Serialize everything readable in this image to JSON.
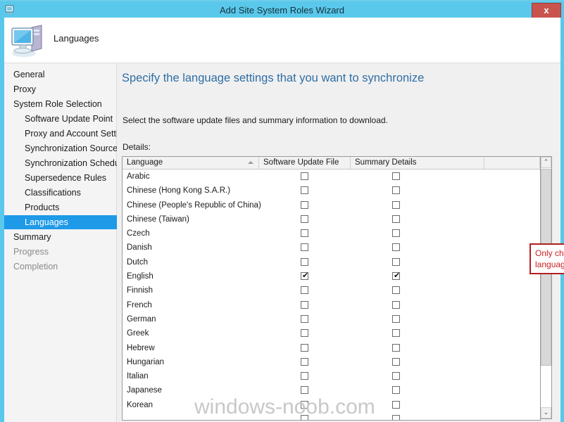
{
  "window": {
    "title": "Add Site System Roles Wizard",
    "close_label": "x",
    "titlebar_color": "#5ac8ea",
    "icon": "wizard-icon"
  },
  "header": {
    "title": "Languages",
    "icon": "computer-icon"
  },
  "sidebar": {
    "items": [
      {
        "label": "General",
        "level": 0,
        "state": "normal"
      },
      {
        "label": "Proxy",
        "level": 0,
        "state": "normal"
      },
      {
        "label": "System Role Selection",
        "level": 0,
        "state": "normal"
      },
      {
        "label": "Software Update Point",
        "level": 1,
        "state": "normal"
      },
      {
        "label": "Proxy and Account Settin",
        "level": 1,
        "state": "normal"
      },
      {
        "label": "Synchronization Source",
        "level": 1,
        "state": "normal"
      },
      {
        "label": "Synchronization Schedul",
        "level": 1,
        "state": "normal"
      },
      {
        "label": "Supersedence Rules",
        "level": 1,
        "state": "normal"
      },
      {
        "label": "Classifications",
        "level": 1,
        "state": "normal"
      },
      {
        "label": "Products",
        "level": 1,
        "state": "normal"
      },
      {
        "label": "Languages",
        "level": 1,
        "state": "selected"
      },
      {
        "label": "Summary",
        "level": 0,
        "state": "normal"
      },
      {
        "label": "Progress",
        "level": 0,
        "state": "dim"
      },
      {
        "label": "Completion",
        "level": 0,
        "state": "dim"
      }
    ],
    "selected_color": "#1e9ae8"
  },
  "main": {
    "heading": "Specify the language settings that you want to synchronize",
    "heading_color": "#2f6ea5",
    "description": "Select the software update files and summary information to download.",
    "details_label": "Details:"
  },
  "table": {
    "columns": [
      {
        "label": "Language",
        "sorted": "ascending"
      },
      {
        "label": "Software Update File",
        "sorted": "none"
      },
      {
        "label": "Summary Details",
        "sorted": "none"
      },
      {
        "label": "",
        "sorted": "none"
      }
    ],
    "rows": [
      {
        "language": "Arabic",
        "software_update_file": false,
        "summary_details": false
      },
      {
        "language": "Chinese (Hong Kong S.A.R.)",
        "software_update_file": false,
        "summary_details": false
      },
      {
        "language": "Chinese (People's Republic of China)",
        "software_update_file": false,
        "summary_details": false
      },
      {
        "language": "Chinese (Taiwan)",
        "software_update_file": false,
        "summary_details": false
      },
      {
        "language": "Czech",
        "software_update_file": false,
        "summary_details": false
      },
      {
        "language": "Danish",
        "software_update_file": false,
        "summary_details": false
      },
      {
        "language": "Dutch",
        "software_update_file": false,
        "summary_details": false
      },
      {
        "language": "English",
        "software_update_file": true,
        "summary_details": true
      },
      {
        "language": "Finnish",
        "software_update_file": false,
        "summary_details": false
      },
      {
        "language": "French",
        "software_update_file": false,
        "summary_details": false
      },
      {
        "language": "German",
        "software_update_file": false,
        "summary_details": false
      },
      {
        "language": "Greek",
        "software_update_file": false,
        "summary_details": false
      },
      {
        "language": "Hebrew",
        "software_update_file": false,
        "summary_details": false
      },
      {
        "language": "Hungarian",
        "software_update_file": false,
        "summary_details": false
      },
      {
        "language": "Italian",
        "software_update_file": false,
        "summary_details": false
      },
      {
        "language": "Japanese",
        "software_update_file": false,
        "summary_details": false
      },
      {
        "language": "Korean",
        "software_update_file": false,
        "summary_details": false
      },
      {
        "language": "",
        "software_update_file": false,
        "summary_details": false
      }
    ],
    "checkmark": "✔"
  },
  "scrollbar": {
    "up_arrow": "⌃",
    "down_arrow": "⌄"
  },
  "annotation": {
    "text": "Only choose the language that you need.",
    "color": "#cc2222",
    "border_color": "#b02020"
  },
  "watermark": {
    "text": "windows-noob.com"
  }
}
